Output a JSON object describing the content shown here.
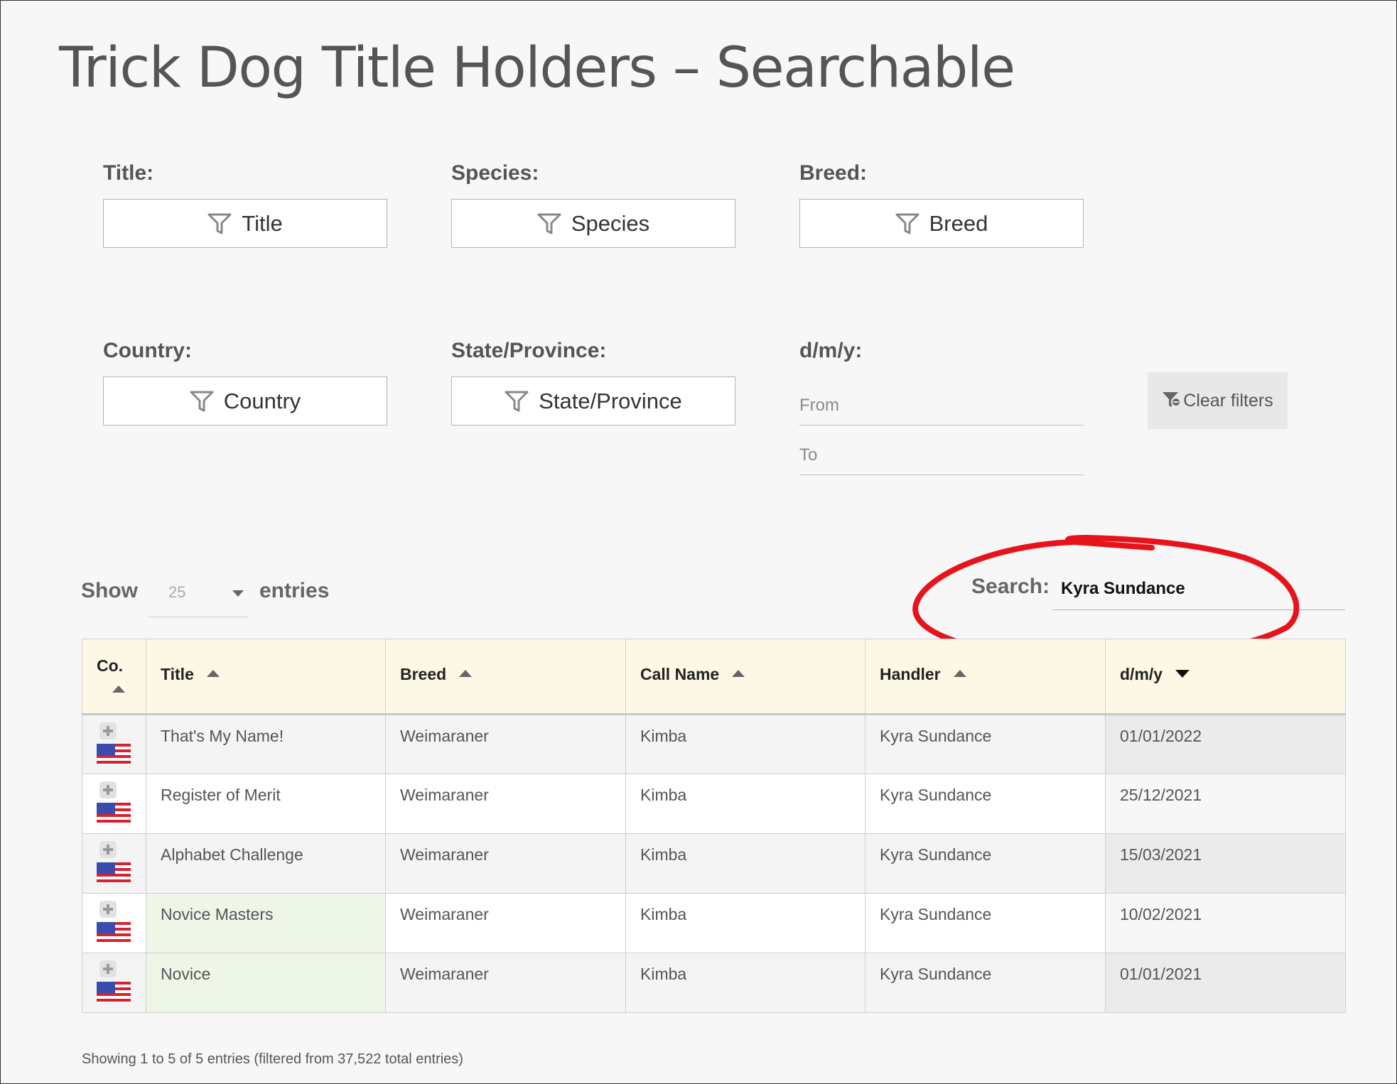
{
  "page": {
    "title": "Trick Dog Title Holders – Searchable"
  },
  "filters": {
    "title": {
      "label": "Title:",
      "button": "Title"
    },
    "species": {
      "label": "Species:",
      "button": "Species"
    },
    "breed": {
      "label": "Breed:",
      "button": "Breed"
    },
    "country": {
      "label": "Country:",
      "button": "Country"
    },
    "state": {
      "label": "State/Province:",
      "button": "State/Province"
    },
    "date": {
      "label": "d/m/y:",
      "from_placeholder": "From",
      "to_placeholder": "To"
    },
    "clear_label": "Clear filters",
    "icons": {
      "filter": "funnel-icon",
      "clear": "funnel-clear-icon"
    }
  },
  "length": {
    "show_label": "Show",
    "value": "25",
    "entries_label": "entries"
  },
  "search": {
    "label": "Search:",
    "value": "Kyra Sundance",
    "annotation_color": "#e8121b"
  },
  "table": {
    "headers": {
      "co": "Co.",
      "title": "Title",
      "breed": "Breed",
      "call_name": "Call Name",
      "handler": "Handler",
      "date": "d/m/y"
    },
    "rows": [
      {
        "country_icon": "us-flag-icon",
        "title": "That's My Name!",
        "breed": "Weimaraner",
        "call_name": "Kimba",
        "handler": "Kyra Sundance",
        "date": "01/01/2022"
      },
      {
        "country_icon": "us-flag-icon",
        "title": "Register of Merit",
        "breed": "Weimaraner",
        "call_name": "Kimba",
        "handler": "Kyra Sundance",
        "date": "25/12/2021"
      },
      {
        "country_icon": "us-flag-icon",
        "title": "Alphabet Challenge",
        "breed": "Weimaraner",
        "call_name": "Kimba",
        "handler": "Kyra Sundance",
        "date": "15/03/2021"
      },
      {
        "country_icon": "us-flag-icon",
        "title": "Novice Masters",
        "breed": "Weimaraner",
        "call_name": "Kimba",
        "handler": "Kyra Sundance",
        "date": "10/02/2021"
      },
      {
        "country_icon": "us-flag-icon",
        "title": "Novice",
        "breed": "Weimaraner",
        "call_name": "Kimba",
        "handler": "Kyra Sundance",
        "date": "01/01/2021"
      }
    ]
  },
  "footer": {
    "info": "Showing 1 to 5 of 5 entries (filtered from 37,522 total entries)"
  }
}
